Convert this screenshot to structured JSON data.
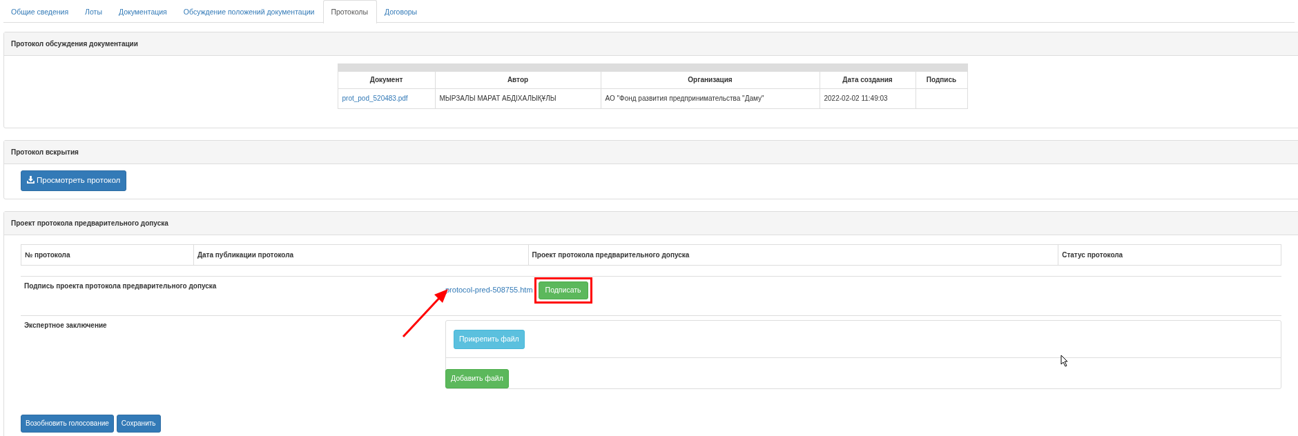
{
  "tabs": [
    {
      "label": "Общие сведения",
      "selected": false
    },
    {
      "label": "Лоты",
      "selected": false
    },
    {
      "label": "Документация",
      "selected": false
    },
    {
      "label": "Обсуждение положений документации",
      "selected": false
    },
    {
      "label": "Протоколы",
      "selected": true
    },
    {
      "label": "Договоры",
      "selected": false
    }
  ],
  "panels": [
    {
      "kind": "documents",
      "title": "Протокол обсуждения документации",
      "table": {
        "columns": [
          "Документ",
          "Автор",
          "Организация",
          "Дата создания",
          "Подпись"
        ],
        "rows": [
          [
            "prot_pod_520483.pdf",
            "МЫРЗАЛЫ МАРАТ АБДІХАЛЫҚҰЛЫ",
            "АО \"Фонд развития предпринимательства \"Даму\"",
            "2022-02-02 11:49:03",
            ""
          ]
        ]
      }
    },
    {
      "kind": "view",
      "title": "Протокол вскрытия",
      "button": "Просмотреть протокол"
    },
    {
      "kind": "draft",
      "title": "Проект протокола предварительного допуска",
      "table": {
        "columns": [
          "№ протокола",
          "Дата публикации протокола",
          "Проект протокола предварительного допуска",
          "Статус протокола"
        ]
      },
      "sign_row": {
        "label": "Подпись проекта протокола предварительного допуска",
        "file": "protocol-pred-508755.htm",
        "button": "Подписать",
        "highlighted": true,
        "arrow": true
      },
      "expert_row": {
        "label": "Экспертное заключение",
        "attach_button": "Прикрепить файл",
        "add_button": "Добавить файл"
      }
    }
  ],
  "footer_buttons": [
    "Возобновить голосование",
    "Сохранить"
  ]
}
